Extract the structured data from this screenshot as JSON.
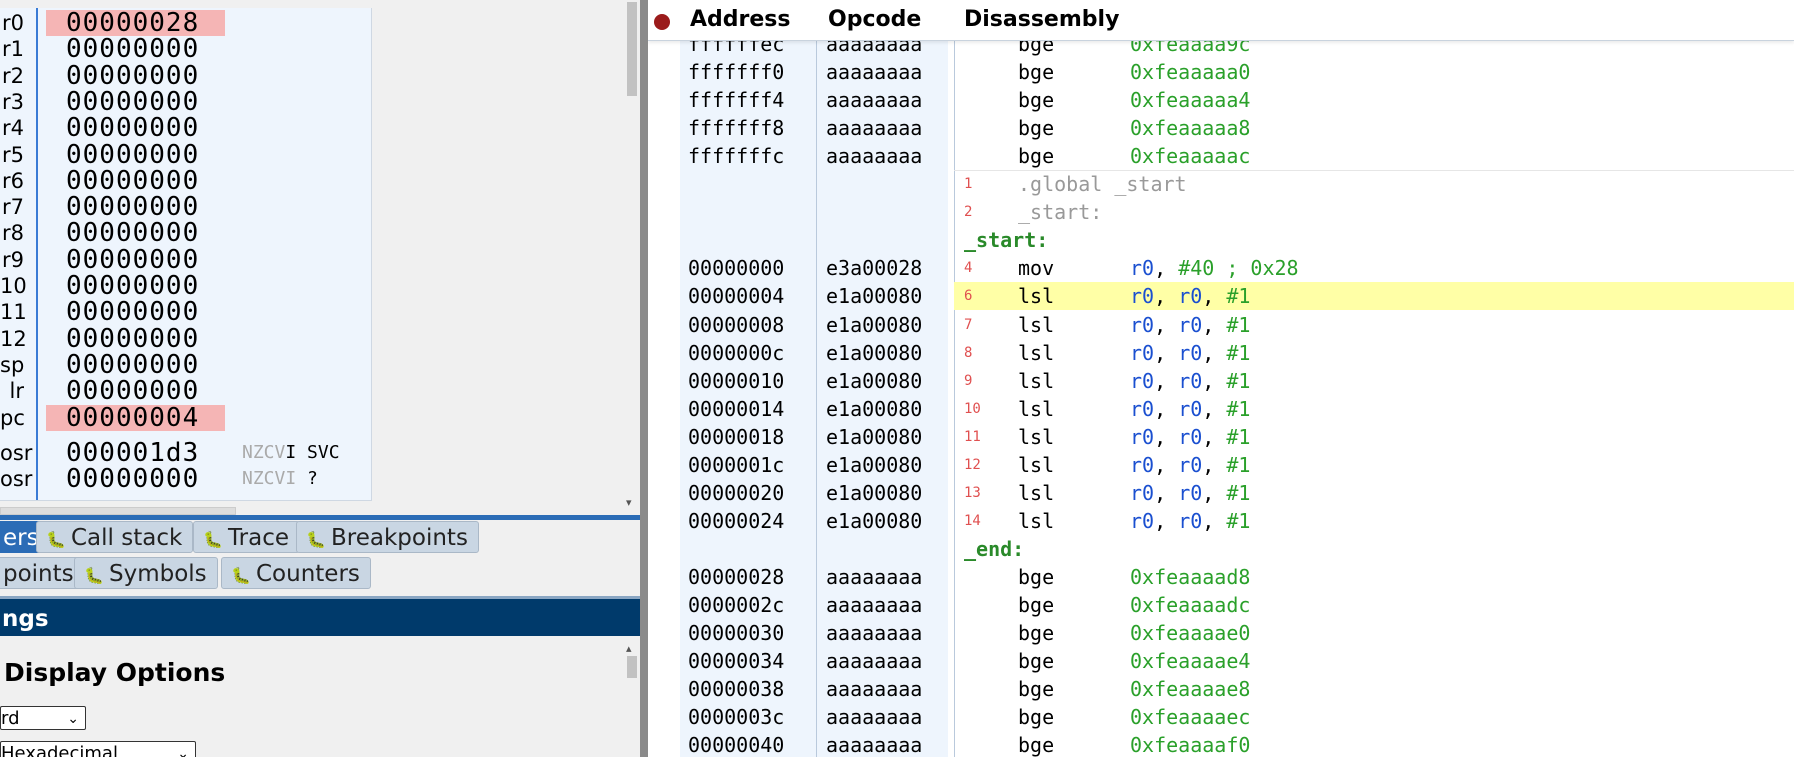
{
  "registers": [
    {
      "name": "r0",
      "value": "00000028",
      "highlight": true
    },
    {
      "name": "r1",
      "value": "00000000",
      "highlight": false
    },
    {
      "name": "r2",
      "value": "00000000",
      "highlight": false
    },
    {
      "name": "r3",
      "value": "00000000",
      "highlight": false
    },
    {
      "name": "r4",
      "value": "00000000",
      "highlight": false
    },
    {
      "name": "r5",
      "value": "00000000",
      "highlight": false
    },
    {
      "name": "r6",
      "value": "00000000",
      "highlight": false
    },
    {
      "name": "r7",
      "value": "00000000",
      "highlight": false
    },
    {
      "name": "r8",
      "value": "00000000",
      "highlight": false
    },
    {
      "name": "r9",
      "value": "00000000",
      "highlight": false
    },
    {
      "name": "10",
      "value": "00000000",
      "highlight": false
    },
    {
      "name": "11",
      "value": "00000000",
      "highlight": false
    },
    {
      "name": "12",
      "value": "00000000",
      "highlight": false
    },
    {
      "name": "sp",
      "value": "00000000",
      "highlight": false
    },
    {
      "name": "lr",
      "value": "00000000",
      "highlight": false
    },
    {
      "name": "pc",
      "value": "00000004",
      "highlight": true
    }
  ],
  "status_registers": [
    {
      "name": "osr",
      "value": "000001d3",
      "flags": "NZCV",
      "flag_i": "I",
      "mode": " SVC"
    },
    {
      "name": "osr",
      "value": "00000000",
      "flags": "NZCVI",
      "flag_i": "",
      "mode": "  ?"
    }
  ],
  "tabs_row1": [
    {
      "label": "ers",
      "active": true,
      "icon": ""
    },
    {
      "label": "Call stack",
      "active": false,
      "icon": "bug-icon"
    },
    {
      "label": "Trace",
      "active": false,
      "icon": "bug-icon"
    },
    {
      "label": "Breakpoints",
      "active": false,
      "icon": "bug-icon"
    }
  ],
  "tabs_row2": [
    {
      "label": "points",
      "active": false,
      "icon": ""
    },
    {
      "label": "Symbols",
      "active": false,
      "icon": "bug-icon"
    },
    {
      "label": "Counters",
      "active": false,
      "icon": "bug-icon"
    }
  ],
  "settings": {
    "header": "ngs",
    "display_title": "Display Options",
    "select1": "rd",
    "select2": "Hexadecimal"
  },
  "disassembly": {
    "headers": {
      "address": "Address",
      "opcode": "Opcode",
      "disassembly": "Disassembly"
    },
    "rows": [
      {
        "kind": "instr",
        "addr": "ffffffec",
        "op": "aaaaaaaa",
        "ln": "",
        "mn": "bge",
        "args": [
          [
            "0xfeaaaa9c",
            "g"
          ]
        ]
      },
      {
        "kind": "instr",
        "addr": "fffffff0",
        "op": "aaaaaaaa",
        "ln": "",
        "mn": "bge",
        "args": [
          [
            "0xfeaaaaa0",
            "g"
          ]
        ]
      },
      {
        "kind": "instr",
        "addr": "fffffff4",
        "op": "aaaaaaaa",
        "ln": "",
        "mn": "bge",
        "args": [
          [
            "0xfeaaaaa4",
            "g"
          ]
        ]
      },
      {
        "kind": "instr",
        "addr": "fffffff8",
        "op": "aaaaaaaa",
        "ln": "",
        "mn": "bge",
        "args": [
          [
            "0xfeaaaaa8",
            "g"
          ]
        ]
      },
      {
        "kind": "instr",
        "addr": "fffffffc",
        "op": "aaaaaaaa",
        "ln": "",
        "mn": "bge",
        "args": [
          [
            "0xfeaaaaac",
            "g"
          ]
        ]
      },
      {
        "kind": "src",
        "ln": "1",
        "text": ".global _start"
      },
      {
        "kind": "src",
        "ln": "2",
        "text": "_start:"
      },
      {
        "kind": "label",
        "text": "_start:"
      },
      {
        "kind": "instr",
        "addr": "00000000",
        "op": "e3a00028",
        "ln": "4",
        "mn": "mov",
        "args": [
          [
            "r0",
            "b"
          ],
          [
            ", ",
            "k"
          ],
          [
            "#40",
            "g"
          ],
          [
            " ; 0x28",
            "g"
          ]
        ]
      },
      {
        "kind": "instr",
        "addr": "00000004",
        "op": "e1a00080",
        "ln": "6",
        "mn": "lsl",
        "hl": true,
        "args": [
          [
            "r0",
            "b"
          ],
          [
            ", ",
            "k"
          ],
          [
            "r0",
            "b"
          ],
          [
            ", ",
            "k"
          ],
          [
            "#1",
            "g"
          ]
        ]
      },
      {
        "kind": "instr",
        "addr": "00000008",
        "op": "e1a00080",
        "ln": "7",
        "mn": "lsl",
        "args": [
          [
            "r0",
            "b"
          ],
          [
            ", ",
            "k"
          ],
          [
            "r0",
            "b"
          ],
          [
            ", ",
            "k"
          ],
          [
            "#1",
            "g"
          ]
        ]
      },
      {
        "kind": "instr",
        "addr": "0000000c",
        "op": "e1a00080",
        "ln": "8",
        "mn": "lsl",
        "args": [
          [
            "r0",
            "b"
          ],
          [
            ", ",
            "k"
          ],
          [
            "r0",
            "b"
          ],
          [
            ", ",
            "k"
          ],
          [
            "#1",
            "g"
          ]
        ]
      },
      {
        "kind": "instr",
        "addr": "00000010",
        "op": "e1a00080",
        "ln": "9",
        "mn": "lsl",
        "args": [
          [
            "r0",
            "b"
          ],
          [
            ", ",
            "k"
          ],
          [
            "r0",
            "b"
          ],
          [
            ", ",
            "k"
          ],
          [
            "#1",
            "g"
          ]
        ]
      },
      {
        "kind": "instr",
        "addr": "00000014",
        "op": "e1a00080",
        "ln": "10",
        "mn": "lsl",
        "args": [
          [
            "r0",
            "b"
          ],
          [
            ", ",
            "k"
          ],
          [
            "r0",
            "b"
          ],
          [
            ", ",
            "k"
          ],
          [
            "#1",
            "g"
          ]
        ]
      },
      {
        "kind": "instr",
        "addr": "00000018",
        "op": "e1a00080",
        "ln": "11",
        "mn": "lsl",
        "args": [
          [
            "r0",
            "b"
          ],
          [
            ", ",
            "k"
          ],
          [
            "r0",
            "b"
          ],
          [
            ", ",
            "k"
          ],
          [
            "#1",
            "g"
          ]
        ]
      },
      {
        "kind": "instr",
        "addr": "0000001c",
        "op": "e1a00080",
        "ln": "12",
        "mn": "lsl",
        "args": [
          [
            "r0",
            "b"
          ],
          [
            ", ",
            "k"
          ],
          [
            "r0",
            "b"
          ],
          [
            ", ",
            "k"
          ],
          [
            "#1",
            "g"
          ]
        ]
      },
      {
        "kind": "instr",
        "addr": "00000020",
        "op": "e1a00080",
        "ln": "13",
        "mn": "lsl",
        "args": [
          [
            "r0",
            "b"
          ],
          [
            ", ",
            "k"
          ],
          [
            "r0",
            "b"
          ],
          [
            ", ",
            "k"
          ],
          [
            "#1",
            "g"
          ]
        ]
      },
      {
        "kind": "instr",
        "addr": "00000024",
        "op": "e1a00080",
        "ln": "14",
        "mn": "lsl",
        "args": [
          [
            "r0",
            "b"
          ],
          [
            ", ",
            "k"
          ],
          [
            "r0",
            "b"
          ],
          [
            ", ",
            "k"
          ],
          [
            "#1",
            "g"
          ]
        ]
      },
      {
        "kind": "label",
        "text": "_end:"
      },
      {
        "kind": "instr",
        "addr": "00000028",
        "op": "aaaaaaaa",
        "ln": "",
        "mn": "bge",
        "args": [
          [
            "0xfeaaaad8",
            "g"
          ]
        ]
      },
      {
        "kind": "instr",
        "addr": "0000002c",
        "op": "aaaaaaaa",
        "ln": "",
        "mn": "bge",
        "args": [
          [
            "0xfeaaaadc",
            "g"
          ]
        ]
      },
      {
        "kind": "instr",
        "addr": "00000030",
        "op": "aaaaaaaa",
        "ln": "",
        "mn": "bge",
        "args": [
          [
            "0xfeaaaae0",
            "g"
          ]
        ]
      },
      {
        "kind": "instr",
        "addr": "00000034",
        "op": "aaaaaaaa",
        "ln": "",
        "mn": "bge",
        "args": [
          [
            "0xfeaaaae4",
            "g"
          ]
        ]
      },
      {
        "kind": "instr",
        "addr": "00000038",
        "op": "aaaaaaaa",
        "ln": "",
        "mn": "bge",
        "args": [
          [
            "0xfeaaaae8",
            "g"
          ]
        ]
      },
      {
        "kind": "instr",
        "addr": "0000003c",
        "op": "aaaaaaaa",
        "ln": "",
        "mn": "bge",
        "args": [
          [
            "0xfeaaaaec",
            "g"
          ]
        ]
      },
      {
        "kind": "instr",
        "addr": "00000040",
        "op": "aaaaaaaa",
        "ln": "",
        "mn": "bge",
        "args": [
          [
            "0xfeaaaaf0",
            "g"
          ]
        ]
      }
    ]
  },
  "colors": {
    "highlight_row": "#ffffa6",
    "register_changed": "#f5b5b5",
    "tab_active": "#2b6cb6",
    "settings_header": "#003a6b",
    "hex_green": "#2aa02a",
    "reg_blue": "#1a4fd0"
  }
}
